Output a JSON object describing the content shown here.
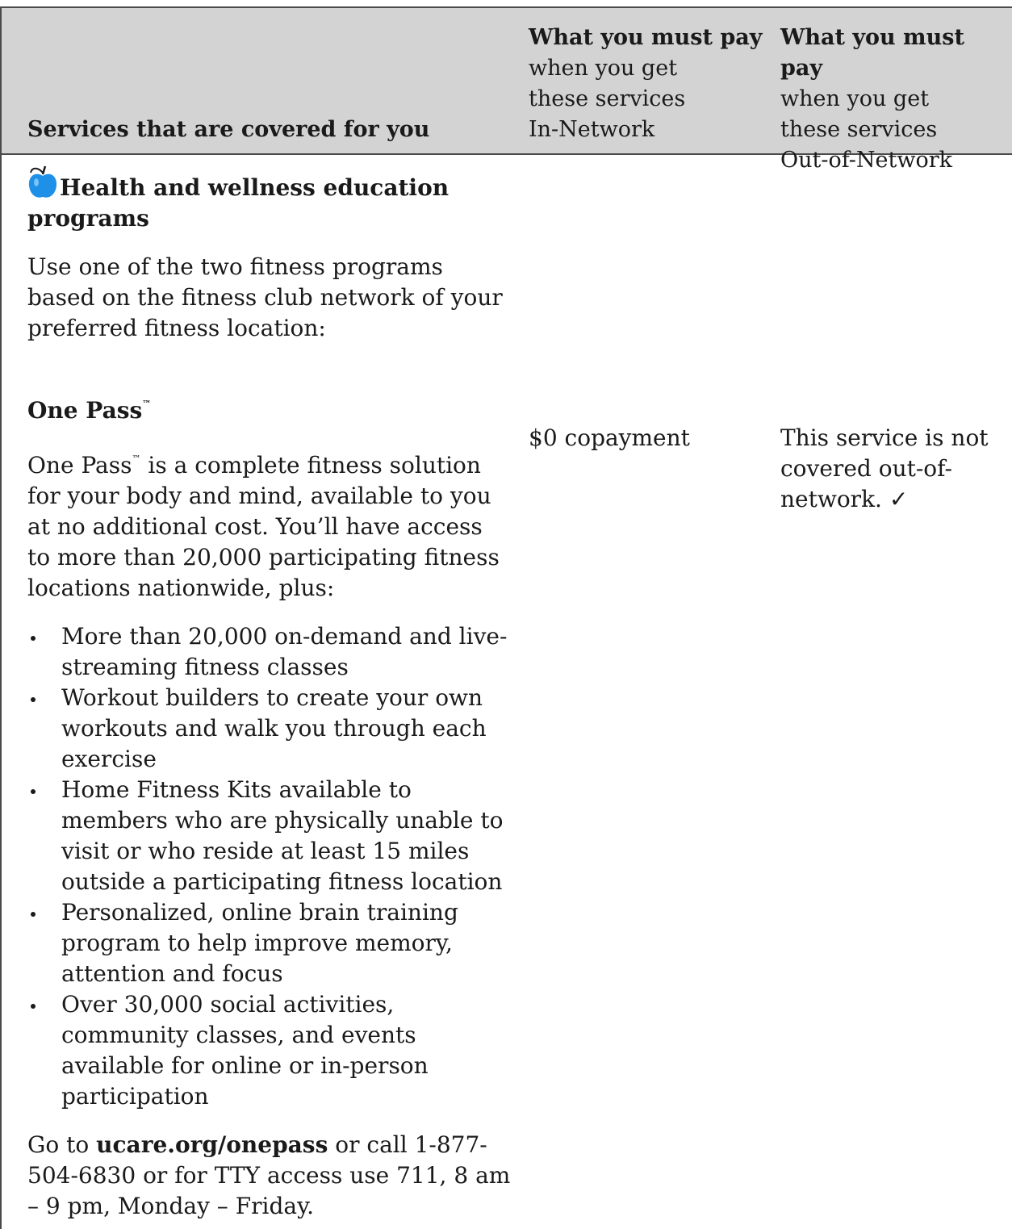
{
  "header": {
    "col1": "Services that are covered for you",
    "col2_bold": "What you must pay",
    "col2_line2": "when you get",
    "col2_line3": "these services",
    "col2_line4": "In-Network",
    "col3_bold": "What you must pay",
    "col3_line2": "when you get",
    "col3_line3": "these services",
    "col3_line4": "Out-of-Network"
  },
  "section": {
    "icon": "apple-icon",
    "title": "Health and wellness education programs",
    "intro": "Use one of the two fitness programs based on the fitness club network of your preferred fitness location:",
    "program_name": "One Pass",
    "tm": "™",
    "desc_name": "One Pass",
    "desc_rest": " is a complete fitness solution for your body and mind, available to you at no additional cost. You’ll have access to more than 20,000 participating fitness locations nationwide, plus:",
    "bullets": [
      "More than 20,000 on-demand and live-streaming fitness classes",
      "Workout builders to create your own workouts and walk you through each exercise",
      "Home Fitness Kits available to members who are physically unable to visit or who reside at least 15 miles outside a participating fitness location",
      "Personalized, online brain training program to help improve memory, attention and focus",
      "Over 30,000 social activities, community classes, and events available for online or in-person participation"
    ],
    "contact_pre": "Go to ",
    "contact_link": "ucare.org/onepass",
    "contact_post": " or call 1-877-504-6830 or for TTY access use 711, 8 am – 9 pm, Monday – Friday.",
    "in_network": "$0 copayment",
    "out_network": "This service is not covered out-of-network. ✓"
  }
}
